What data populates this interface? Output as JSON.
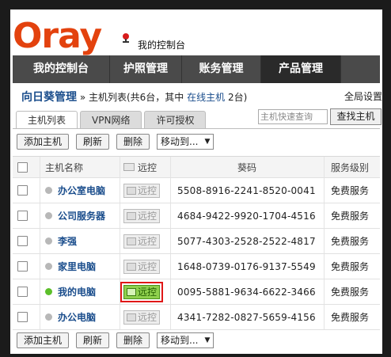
{
  "brand": {
    "logo": "Oray",
    "console_title": "我的控制台"
  },
  "nav": [
    "我的控制台",
    "护照管理",
    "账务管理",
    "产品管理"
  ],
  "breadcrumb": {
    "main": "向日葵管理",
    "sep": " » ",
    "text_before": "主机列表(共6台，其中 ",
    "online_link": "在线主机",
    "text_after": " 2台)"
  },
  "global_settings": "全局设置",
  "tabs": [
    "主机列表",
    "VPN网络",
    "许可授权"
  ],
  "search": {
    "placeholder": "主机快速查询",
    "button": "查找主机"
  },
  "toolbar": {
    "add": "添加主机",
    "refresh": "刷新",
    "delete": "删除",
    "move": "移动到..."
  },
  "table": {
    "headers": {
      "name": "主机名称",
      "remote": "远控",
      "code": "葵码",
      "level": "服务级别"
    },
    "rows": [
      {
        "name": "办公室电脑",
        "remote": "远控",
        "code": "5508-8916-2241-8520-0041",
        "level": "免费服务",
        "online": false
      },
      {
        "name": "公司服务器",
        "remote": "远控",
        "code": "4684-9422-9920-1704-4516",
        "level": "免费服务",
        "online": false
      },
      {
        "name": "李强",
        "remote": "远控",
        "code": "5077-4303-2528-2522-4817",
        "level": "免费服务",
        "online": false
      },
      {
        "name": "家里电脑",
        "remote": "远控",
        "code": "1648-0739-0176-9137-5549",
        "level": "免费服务",
        "online": false
      },
      {
        "name": "我的电脑",
        "remote": "远控",
        "code": "0095-5881-9634-6622-3466",
        "level": "免费服务",
        "online": true
      },
      {
        "name": "办公电脑",
        "remote": "远控",
        "code": "4341-7282-0827-5659-4156",
        "level": "免费服务",
        "online": false
      }
    ]
  },
  "colors": {
    "brand": "#e3420e",
    "link": "#1a4d8c",
    "online": "#5cbf2a",
    "highlight": "#e01717"
  }
}
